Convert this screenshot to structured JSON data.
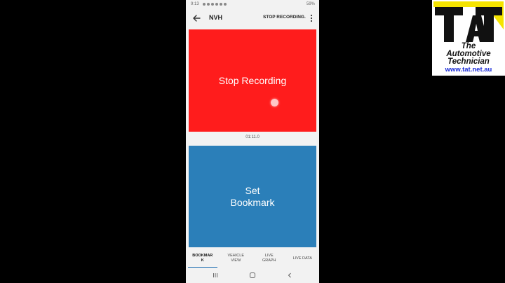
{
  "status_bar": {
    "time": "9:13",
    "battery": "59%"
  },
  "app_bar": {
    "title": "NVH",
    "stop_link": "STOP RECORDING."
  },
  "main": {
    "stop_button_label": "Stop Recording",
    "timer": "01:11.0",
    "bookmark_button_label": "Set\nBookmark"
  },
  "tabs": [
    {
      "label": "BOOKMAR\nK",
      "active": true
    },
    {
      "label": "VEHICLE\nVIEW",
      "active": false
    },
    {
      "label": "LIVE\nGRAPH",
      "active": false
    },
    {
      "label": "LIVE DATA",
      "active": false
    }
  ],
  "logo": {
    "mark_text": "TAT",
    "line1": "The",
    "line2": "Automotive",
    "line3": "Technician",
    "url": "www.tat.net.au"
  },
  "colors": {
    "stop_red": "#ff1c1c",
    "bookmark_blue": "#2b7fb9",
    "logo_yellow": "#f5e400",
    "url_blue": "#1a2bd8"
  },
  "icons": {
    "back": "back-arrow-icon",
    "more": "more-vert-icon",
    "nav_recents": "recents-icon",
    "nav_home": "home-icon",
    "nav_back": "nav-back-icon"
  }
}
